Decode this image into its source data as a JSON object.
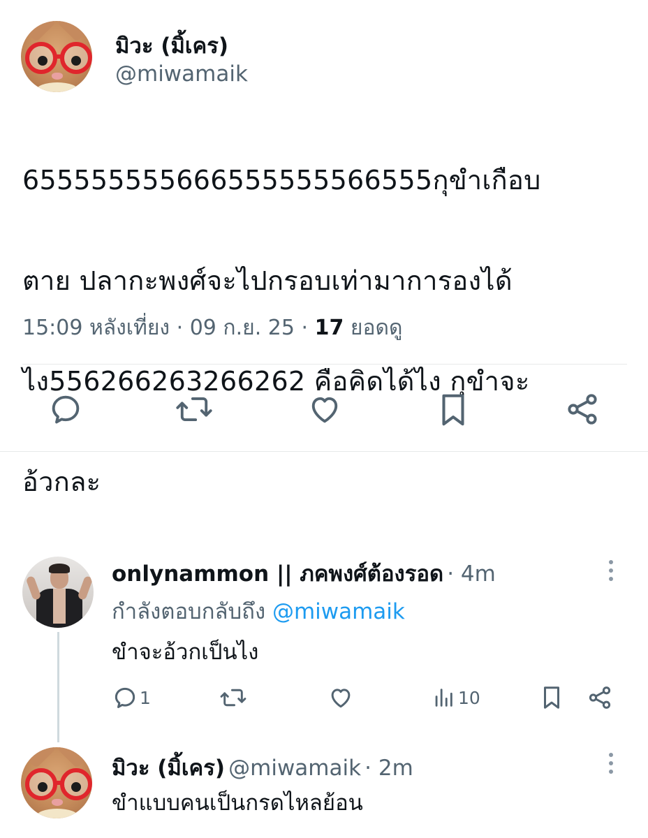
{
  "main_tweet": {
    "display_name": "มิวะ (มิ้เคร)",
    "handle": "@miwamaik",
    "text_lines": [
      "655555555666555555566555กุขำเกือบ",
      "ตาย ปลากะพงศ์จะไปกรอบเท่ามาการองได้",
      "ไง556266263266262 คือคิดได้ไง กุขำจะ",
      "อ้วกละ"
    ],
    "time": "15:09 หลังเที่ยง",
    "separator": "·",
    "date": "09 ก.ย. 25",
    "views_count": "17",
    "views_label": "ยอดดู",
    "actions": [
      "reply-icon",
      "retweet-icon",
      "like-icon",
      "bookmark-icon",
      "share-icon"
    ]
  },
  "replies": [
    {
      "display_name": "onlynammon || ภคพงศ์ต้องรอด",
      "time_suffix": "· 4m",
      "replying_label": "กำลังตอบกลับถึง",
      "replying_to": "@miwamaik",
      "text": "ขำจะอ้วกเป็นไง",
      "reply_count": "1",
      "views_count": "10"
    },
    {
      "display_name": "มิวะ (มิ้เคร)",
      "handle": "@miwamaik",
      "time_suffix": "· 2m",
      "text": "ขำแบบคนเป็นกรดไหลย้อน"
    }
  ],
  "colors": {
    "text": "#0f1419",
    "muted": "#536471",
    "link": "#1d9bf0",
    "divider": "#e7e9ea"
  }
}
